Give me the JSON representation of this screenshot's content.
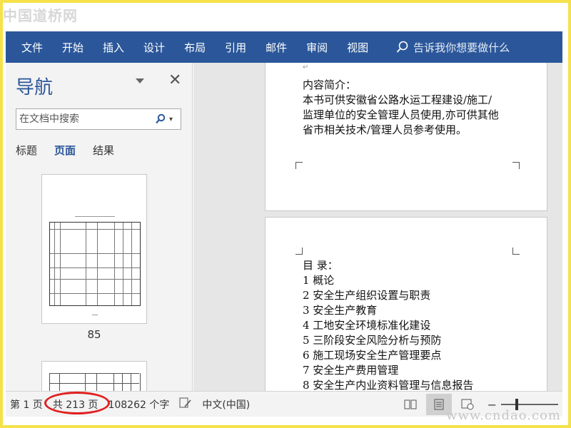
{
  "watermark_top": "中国道桥网",
  "watermark_bottom": "www.cndao.com",
  "ribbon": {
    "tabs": [
      "文件",
      "开始",
      "插入",
      "设计",
      "布局",
      "引用",
      "邮件",
      "审阅",
      "视图"
    ],
    "tell_me": "告诉我你想要做什么"
  },
  "nav": {
    "title": "导航",
    "search_placeholder": "在文档中搜索",
    "tabs": [
      "标题",
      "页面",
      "结果"
    ],
    "active_tab": "页面",
    "thumb_page_number": "85"
  },
  "document": {
    "page1_lines": [
      "内容简介：",
      "本书可供安徽省公路水运工程建设/施工/",
      "监理单位的安全管理人员使用,亦可供其他",
      "省市相关技术/管理人员参考使用。"
    ],
    "page2_lines": [
      "目  录：",
      "1  概论",
      "2  安全生产组织设置与职责",
      "3  安全生产教育",
      "4  工地安全环境标准化建设",
      "5  三阶段安全风险分析与预防",
      "6  施工现场安全生产管理要点",
      "7  安全生产费用管理",
      "8  安全生产内业资料管理与信息报告"
    ]
  },
  "status": {
    "page": "第 1 页",
    "total": "共 213 页",
    "words": "108262 个字",
    "language": "中文(中国)"
  },
  "colors": {
    "ribbon": "#2b579a",
    "frame_border": "#f5e24a",
    "highlight_circle": "#e02020"
  }
}
